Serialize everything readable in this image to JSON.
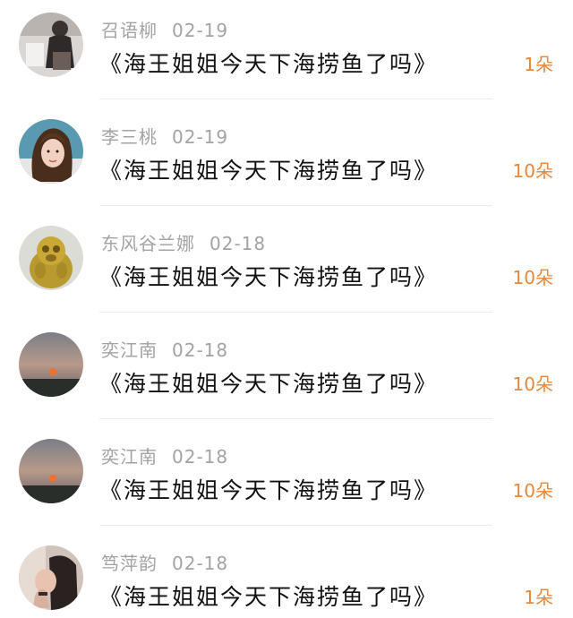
{
  "rows": [
    {
      "name": "召语柳",
      "date": "02-19",
      "title": "《海王姐姐今天下海捞鱼了吗》",
      "count": "1朵"
    },
    {
      "name": "李三桃",
      "date": "02-19",
      "title": "《海王姐姐今天下海捞鱼了吗》",
      "count": "10朵"
    },
    {
      "name": "东风谷兰娜",
      "date": "02-18",
      "title": "《海王姐姐今天下海捞鱼了吗》",
      "count": "10朵"
    },
    {
      "name": "奕江南",
      "date": "02-18",
      "title": "《海王姐姐今天下海捞鱼了吗》",
      "count": "10朵"
    },
    {
      "name": "奕江南",
      "date": "02-18",
      "title": "《海王姐姐今天下海捞鱼了吗》",
      "count": "10朵"
    },
    {
      "name": "笃萍韵",
      "date": "02-18",
      "title": "《海王姐姐今天下海捞鱼了吗》",
      "count": "1朵"
    }
  ],
  "colors": {
    "count_accent": "#e8873a",
    "meta_text": "#a3a3a3",
    "title_text": "#111111"
  }
}
